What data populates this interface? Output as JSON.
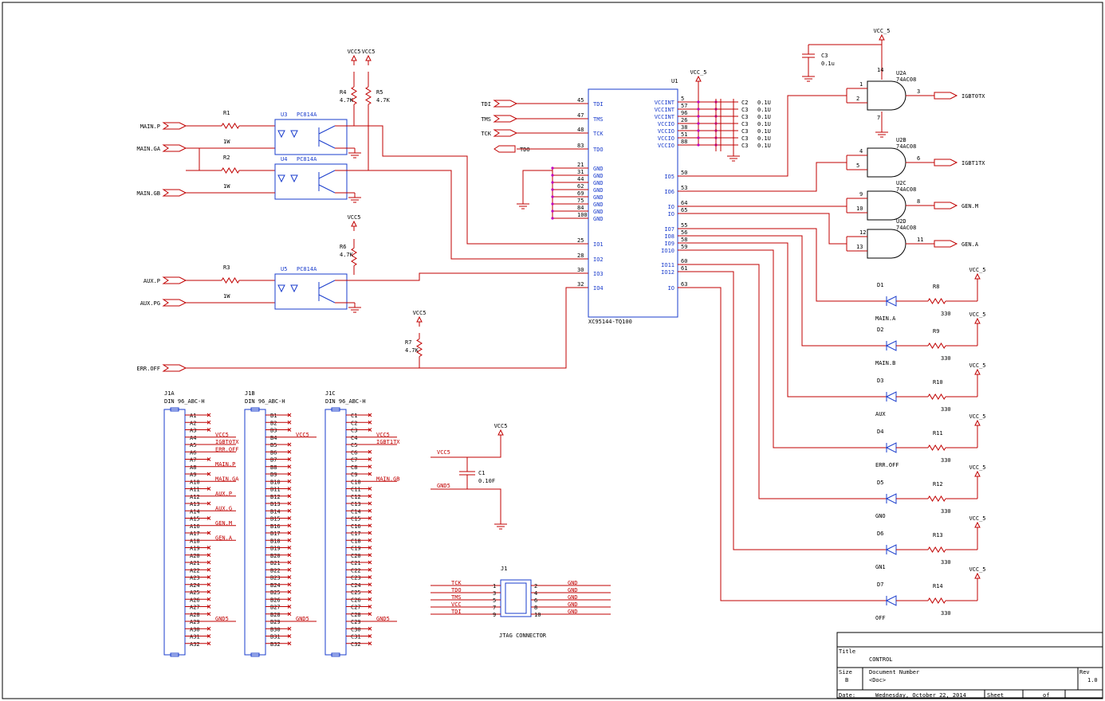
{
  "ports_left": {
    "main_p": "MAIN.P",
    "main_ga": "MAIN.GA",
    "main_gb": "MAIN.GB",
    "aux_p": "AUX.P",
    "aux_pg": "AUX.PG",
    "err_off": "ERR.OFF"
  },
  "opto": {
    "u3": "U3",
    "u4": "U4",
    "u5": "U5",
    "part": "PC814A",
    "r1": "R1",
    "r2": "R2",
    "r3": "R3",
    "rval": "1W"
  },
  "pullups": {
    "vcc5": "VCC5",
    "vcc5_pair": "VCC5VCC5",
    "r4": "R4",
    "r5": "R5",
    "r6": "R6",
    "r7": "R7",
    "val": "4.7K"
  },
  "jtag_ports": {
    "tdi": "TDI",
    "tms": "TMS",
    "tck": "TCK",
    "tdo": "TDO"
  },
  "u1": {
    "ref": "U1",
    "part": "XC95144-TQ100",
    "left_pins": [
      {
        "num": "45",
        "name": "TDI"
      },
      {
        "num": "47",
        "name": "TMS"
      },
      {
        "num": "48",
        "name": "TCK"
      },
      {
        "num": "83",
        "name": "TDO"
      },
      {
        "num": "21",
        "name": "GND"
      },
      {
        "num": "31",
        "name": "GND"
      },
      {
        "num": "44",
        "name": "GND"
      },
      {
        "num": "62",
        "name": "GND"
      },
      {
        "num": "69",
        "name": "GND"
      },
      {
        "num": "75",
        "name": "GND"
      },
      {
        "num": "84",
        "name": "GND"
      },
      {
        "num": "100",
        "name": "GND"
      },
      {
        "num": "25",
        "name": "IO1"
      },
      {
        "num": "28",
        "name": "IO2"
      },
      {
        "num": "30",
        "name": "IO3"
      },
      {
        "num": "32",
        "name": "IO4"
      }
    ],
    "right_pins": [
      {
        "num": "5",
        "name": "VCCINT"
      },
      {
        "num": "57",
        "name": "VCCINT"
      },
      {
        "num": "96",
        "name": "VCCINT"
      },
      {
        "num": "26",
        "name": "VCCIO"
      },
      {
        "num": "38",
        "name": "VCCIO"
      },
      {
        "num": "51",
        "name": "VCCIO"
      },
      {
        "num": "88",
        "name": "VCCIO"
      },
      {
        "num": "50",
        "name": "IO5"
      },
      {
        "num": "53",
        "name": "IO6"
      },
      {
        "num": "64",
        "name": "IO"
      },
      {
        "num": "65",
        "name": "IO"
      },
      {
        "num": "55",
        "name": "IO7"
      },
      {
        "num": "56",
        "name": "IO8"
      },
      {
        "num": "58",
        "name": "IO9"
      },
      {
        "num": "59",
        "name": "IO10"
      },
      {
        "num": "60",
        "name": "IO11"
      },
      {
        "num": "61",
        "name": "IO12"
      },
      {
        "num": "63",
        "name": "IO"
      }
    ],
    "vcc": "VCC_5"
  },
  "decaps": [
    {
      "ref": "C2",
      "val": "0.1U"
    },
    {
      "ref": "C3",
      "val": "0.1U"
    },
    {
      "ref": "C3",
      "val": "0.1U"
    },
    {
      "ref": "C3",
      "val": "0.1U"
    },
    {
      "ref": "C3",
      "val": "0.1U"
    },
    {
      "ref": "C3",
      "val": "0.1U"
    },
    {
      "ref": "C3",
      "val": "0.1U"
    }
  ],
  "c3top": {
    "ref": "C3",
    "val": "0.1u",
    "vcc": "VCC_5"
  },
  "gates": [
    {
      "ref": "U2A",
      "part": "74AC08",
      "in1": "1",
      "in2": "2",
      "out": "3",
      "port": "IGBT0TX"
    },
    {
      "ref": "U2B",
      "part": "74AC08",
      "in1": "4",
      "in2": "5",
      "out": "6",
      "port": "IGBT1TX"
    },
    {
      "ref": "U2C",
      "part": "74AC08",
      "in1": "9",
      "in2": "10",
      "out": "8",
      "port": "GEN.M"
    },
    {
      "ref": "U2D",
      "part": "74AC08",
      "in1": "12",
      "in2": "13",
      "out": "11",
      "port": "GEN.A"
    }
  ],
  "gate_pwr": {
    "p14": "14",
    "p7": "7"
  },
  "leds": [
    {
      "ref": "D1",
      "name": "MAIN.A",
      "r": "R8",
      "rv": "330",
      "vcc": "VCC_5"
    },
    {
      "ref": "D2",
      "name": "MAIN.B",
      "r": "R9",
      "rv": "330",
      "vcc": "VCC_5"
    },
    {
      "ref": "D3",
      "name": "AUX",
      "r": "R10",
      "rv": "330",
      "vcc": "VCC_5"
    },
    {
      "ref": "D4",
      "name": "ERR.OFF",
      "r": "R11",
      "rv": "330",
      "vcc": "VCC_5"
    },
    {
      "ref": "D5",
      "name": "GNO",
      "r": "R12",
      "rv": "330",
      "vcc": "VCC_5"
    },
    {
      "ref": "D6",
      "name": "GN1",
      "r": "R13",
      "rv": "330",
      "vcc": "VCC_5"
    },
    {
      "ref": "D7",
      "name": "OFF",
      "r": "R14",
      "rv": "330",
      "vcc": "VCC_5"
    }
  ],
  "connectors": [
    {
      "ref": "J1A",
      "part": "DIN 96_ABC-H",
      "prefix": "A",
      "nets": {
        "4": "VCC5",
        "5": "IGBT0TX",
        "6": "ERR.OFF",
        "8": "MAIN.P",
        "10": "MAIN.GA",
        "12": "AUX.P",
        "14": "AUX.G",
        "16": "GEN.M",
        "18": "GEN.A",
        "29": "GND5"
      }
    },
    {
      "ref": "J1B",
      "part": "DIN 96_ABC-H",
      "prefix": "B",
      "nets": {
        "4": "VCC5",
        "29": "GND5"
      }
    },
    {
      "ref": "J1C",
      "part": "DIN 96_ABC-H",
      "prefix": "C",
      "nets": {
        "4": "VCC5",
        "5": "IGBT1TX",
        "10": "MAIN.GB",
        "29": "GND5"
      }
    }
  ],
  "bulk_cap": {
    "ref": "C1",
    "val": "0.10F",
    "vcc": "VCC5",
    "vnet": "VCC5",
    "gnet": "GND5"
  },
  "jtag": {
    "ref": "J1",
    "title": "JTAG CONNECTOR",
    "left": [
      {
        "net": "TCK",
        "pin": "1"
      },
      {
        "net": "TDO",
        "pin": "3"
      },
      {
        "net": "TMS",
        "pin": "5"
      },
      {
        "net": "VCC",
        "pin": "7"
      },
      {
        "net": "TDI",
        "pin": "9"
      }
    ],
    "right": [
      {
        "pin": "2",
        "net": "GND"
      },
      {
        "pin": "4",
        "net": "GND"
      },
      {
        "pin": "6",
        "net": "GND"
      },
      {
        "pin": "8",
        "net": "GND"
      },
      {
        "pin": "10",
        "net": "GND"
      }
    ]
  },
  "title_block": {
    "title_label": "Title",
    "title": "CONTROL",
    "size_label": "Size",
    "size": "B",
    "docnum_label": "Document Number",
    "docnum": "<Doc>",
    "rev_label": "Rev",
    "rev": "1.0",
    "date_label": "Date:",
    "date": "Wednesday, October 22, 2014",
    "sheet_label": "Sheet",
    "of_label": "of"
  }
}
